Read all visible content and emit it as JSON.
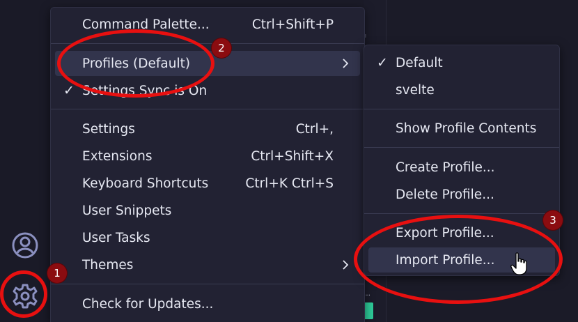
{
  "main_menu": {
    "items": [
      {
        "label": "Command Palette...",
        "shortcut": "Ctrl+Shift+P"
      },
      {
        "label": "Profiles (Default)",
        "shortcut": ""
      },
      {
        "label": "Settings Sync is On",
        "shortcut": ""
      },
      {
        "label": "Settings",
        "shortcut": "Ctrl+,"
      },
      {
        "label": "Extensions",
        "shortcut": "Ctrl+Shift+X"
      },
      {
        "label": "Keyboard Shortcuts",
        "shortcut": "Ctrl+K Ctrl+S"
      },
      {
        "label": "User Snippets",
        "shortcut": ""
      },
      {
        "label": "User Tasks",
        "shortcut": ""
      },
      {
        "label": "Themes",
        "shortcut": ""
      },
      {
        "label": "Check for Updates...",
        "shortcut": ""
      }
    ],
    "check_glyph": "✓"
  },
  "profiles_submenu": {
    "items": [
      {
        "label": "Default"
      },
      {
        "label": "svelte"
      },
      {
        "label": "Show Profile Contents"
      },
      {
        "label": "Create Profile..."
      },
      {
        "label": "Delete Profile..."
      },
      {
        "label": "Export Profile..."
      },
      {
        "label": "Import Profile..."
      }
    ],
    "check_glyph": "✓"
  },
  "activity_bar": {
    "account_icon": "account-icon",
    "settings_icon": "gear-icon"
  },
  "annotations": {
    "badges": [
      "1",
      "2",
      "3"
    ],
    "color": "#e81010"
  },
  "colors": {
    "menu_background": "#222233",
    "hover_background": "#32344c",
    "text": "#e6e8f2"
  }
}
